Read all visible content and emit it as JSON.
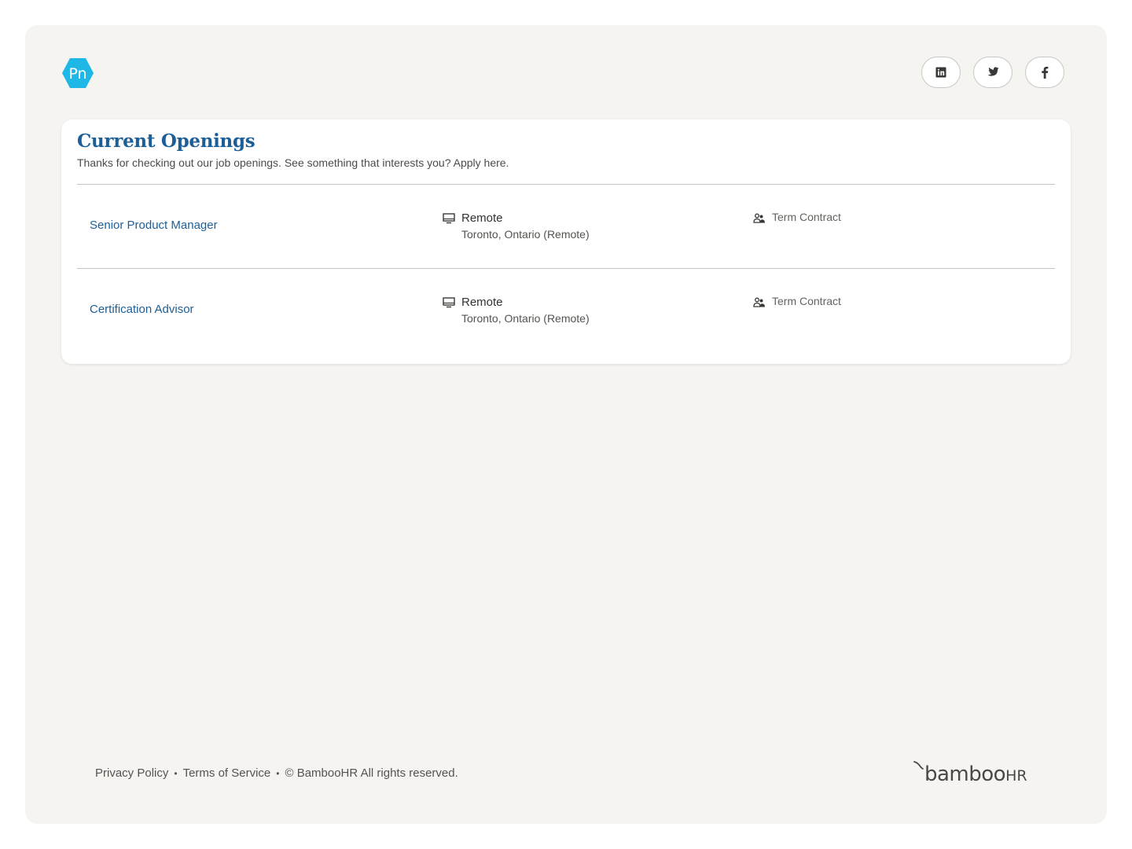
{
  "header": {
    "logo_text": "Pn",
    "social": [
      {
        "name": "linkedin",
        "icon": "linkedin-icon"
      },
      {
        "name": "twitter",
        "icon": "twitter-icon"
      },
      {
        "name": "facebook",
        "icon": "facebook-icon"
      }
    ]
  },
  "openings": {
    "title": "Current Openings",
    "subtitle": "Thanks for checking out our job openings. See something that interests you? Apply here.",
    "jobs": [
      {
        "title": "Senior Product Manager",
        "location_type": "Remote",
        "location": "Toronto, Ontario (Remote)",
        "employment_type": "Term Contract"
      },
      {
        "title": "Certification Advisor",
        "location_type": "Remote",
        "location": "Toronto, Ontario (Remote)",
        "employment_type": "Term Contract"
      }
    ]
  },
  "footer": {
    "privacy": "Privacy Policy",
    "terms": "Terms of Service",
    "copyright": "© BambooHR All rights reserved.",
    "separator": "•",
    "brand_main": "bamboo",
    "brand_suffix": "HR"
  },
  "colors": {
    "accent": "#1c5f98",
    "logo": "#1fb8e6",
    "background": "#f5f4f1"
  }
}
